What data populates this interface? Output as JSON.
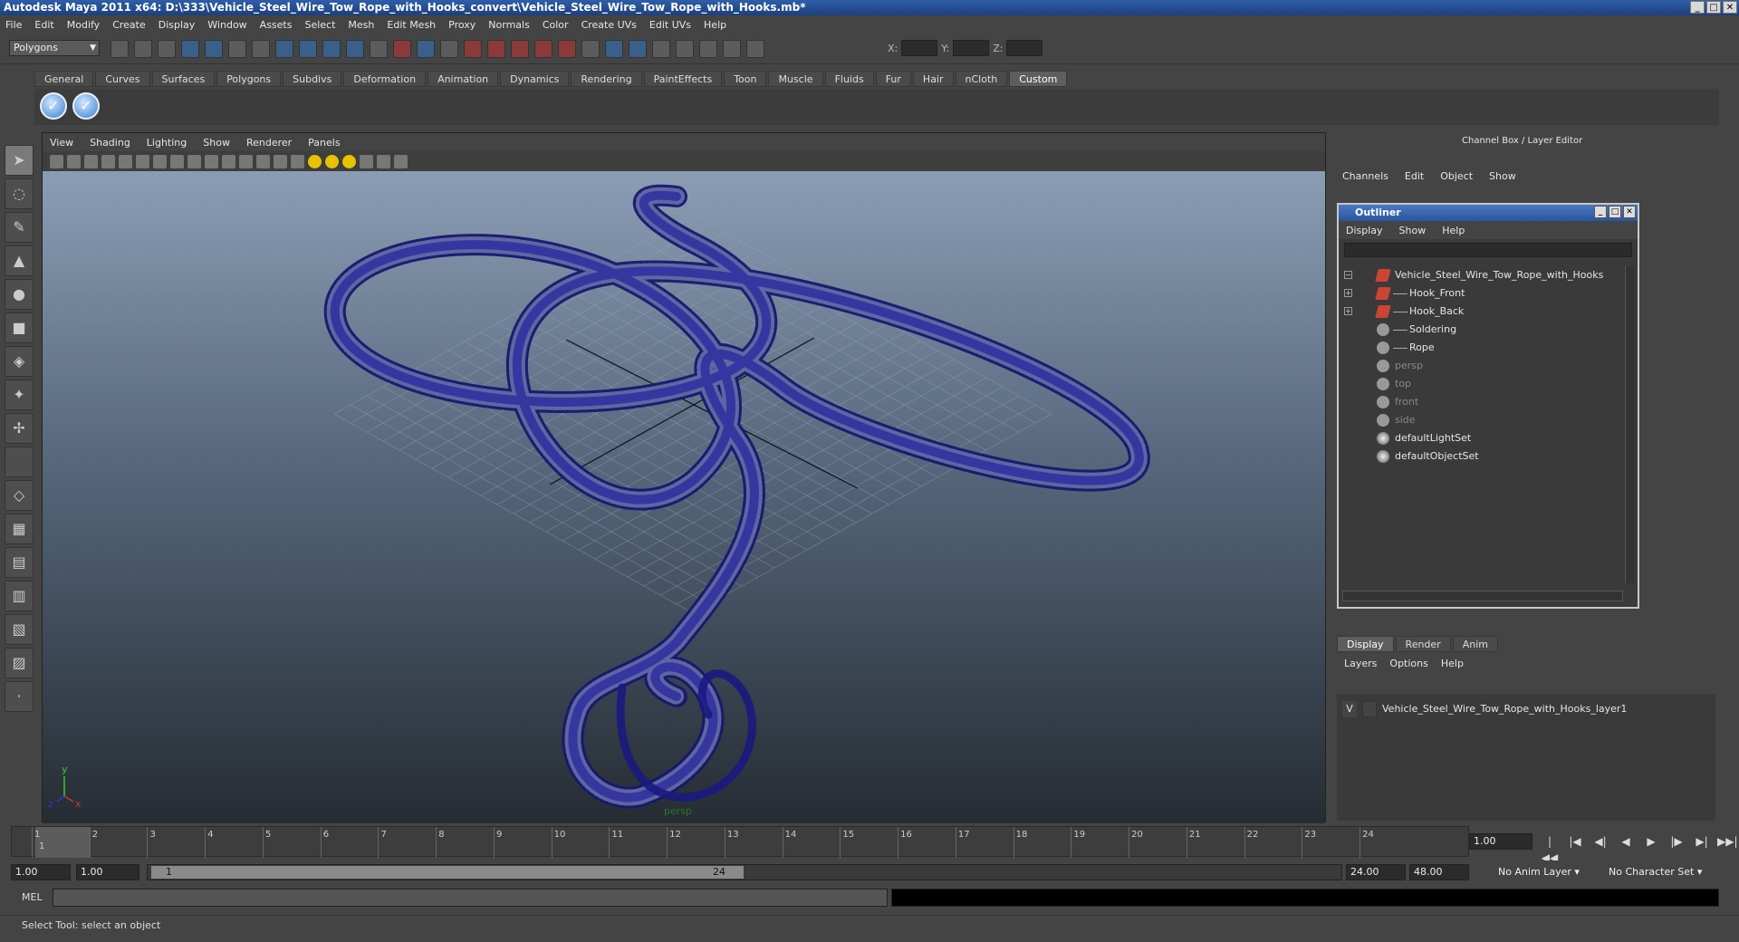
{
  "window": {
    "title": "Autodesk Maya 2011 x64: D:\\333\\Vehicle_Steel_Wire_Tow_Rope_with_Hooks_convert\\Vehicle_Steel_Wire_Tow_Rope_with_Hooks.mb*"
  },
  "menubar": [
    "File",
    "Edit",
    "Modify",
    "Create",
    "Display",
    "Window",
    "Assets",
    "Select",
    "Mesh",
    "Edit Mesh",
    "Proxy",
    "Normals",
    "Color",
    "Create UVs",
    "Edit UVs",
    "Help"
  ],
  "toolbar": {
    "mode": "Polygons",
    "x_label": "X:",
    "y_label": "Y:",
    "z_label": "Z:"
  },
  "shelf_tabs": [
    "General",
    "Curves",
    "Surfaces",
    "Polygons",
    "Subdivs",
    "Deformation",
    "Animation",
    "Dynamics",
    "Rendering",
    "PaintEffects",
    "Toon",
    "Muscle",
    "Fluids",
    "Fur",
    "Hair",
    "nCloth",
    "Custom"
  ],
  "shelf_active": "Custom",
  "viewport": {
    "menu": [
      "View",
      "Shading",
      "Lighting",
      "Show",
      "Renderer",
      "Panels"
    ],
    "camera": "persp",
    "axis": {
      "y": "y",
      "x": "x",
      "z": "z"
    },
    "wire_color": "#1a1a8a"
  },
  "channelbox": {
    "title": "Channel Box / Layer Editor",
    "menu": [
      "Channels",
      "Edit",
      "Object",
      "Show"
    ]
  },
  "outliner": {
    "title": "Outliner",
    "menu": [
      "Display",
      "Show",
      "Help"
    ],
    "items": [
      {
        "label": "Vehicle_Steel_Wire_Tow_Rope_with_Hooks",
        "icon": "mesh-icon",
        "dim": false,
        "exp": "−"
      },
      {
        "label": "Hook_Front",
        "icon": "mesh-icon",
        "dim": false,
        "exp": "+"
      },
      {
        "label": "Hook_Back",
        "icon": "mesh-icon",
        "dim": false,
        "exp": "+"
      },
      {
        "label": "Soldering",
        "icon": "group-icon",
        "dim": false,
        "exp": ""
      },
      {
        "label": "Rope",
        "icon": "group-icon",
        "dim": false,
        "exp": ""
      },
      {
        "label": "persp",
        "icon": "camera-icon",
        "dim": true,
        "exp": ""
      },
      {
        "label": "top",
        "icon": "camera-icon",
        "dim": true,
        "exp": ""
      },
      {
        "label": "front",
        "icon": "camera-icon",
        "dim": true,
        "exp": ""
      },
      {
        "label": "side",
        "icon": "camera-icon",
        "dim": true,
        "exp": ""
      },
      {
        "label": "defaultLightSet",
        "icon": "set-icon",
        "dim": false,
        "exp": ""
      },
      {
        "label": "defaultObjectSet",
        "icon": "set-icon",
        "dim": false,
        "exp": ""
      }
    ]
  },
  "layer_editor": {
    "tabs": [
      "Display",
      "Render",
      "Anim"
    ],
    "active": "Display",
    "menu": [
      "Layers",
      "Options",
      "Help"
    ],
    "layer": {
      "visible": "V",
      "name": "Vehicle_Steel_Wire_Tow_Rope_with_Hooks_layer1"
    }
  },
  "timeline": {
    "frames": [
      "1",
      "2",
      "3",
      "4",
      "5",
      "6",
      "7",
      "8",
      "9",
      "10",
      "11",
      "12",
      "13",
      "14",
      "15",
      "16",
      "17",
      "18",
      "19",
      "20",
      "21",
      "22",
      "23",
      "24"
    ],
    "current_label": "1",
    "current_frame": "1.00"
  },
  "range": {
    "start": "1.00",
    "playback_start": "1.00",
    "slider_start": "1",
    "slider_end": "24",
    "playback_end": "24.00",
    "end": "48.00",
    "anim_layer": "No Anim Layer",
    "char_set": "No Character Set"
  },
  "cmdline": {
    "label": "MEL"
  },
  "helpline": "Select Tool: select an object"
}
